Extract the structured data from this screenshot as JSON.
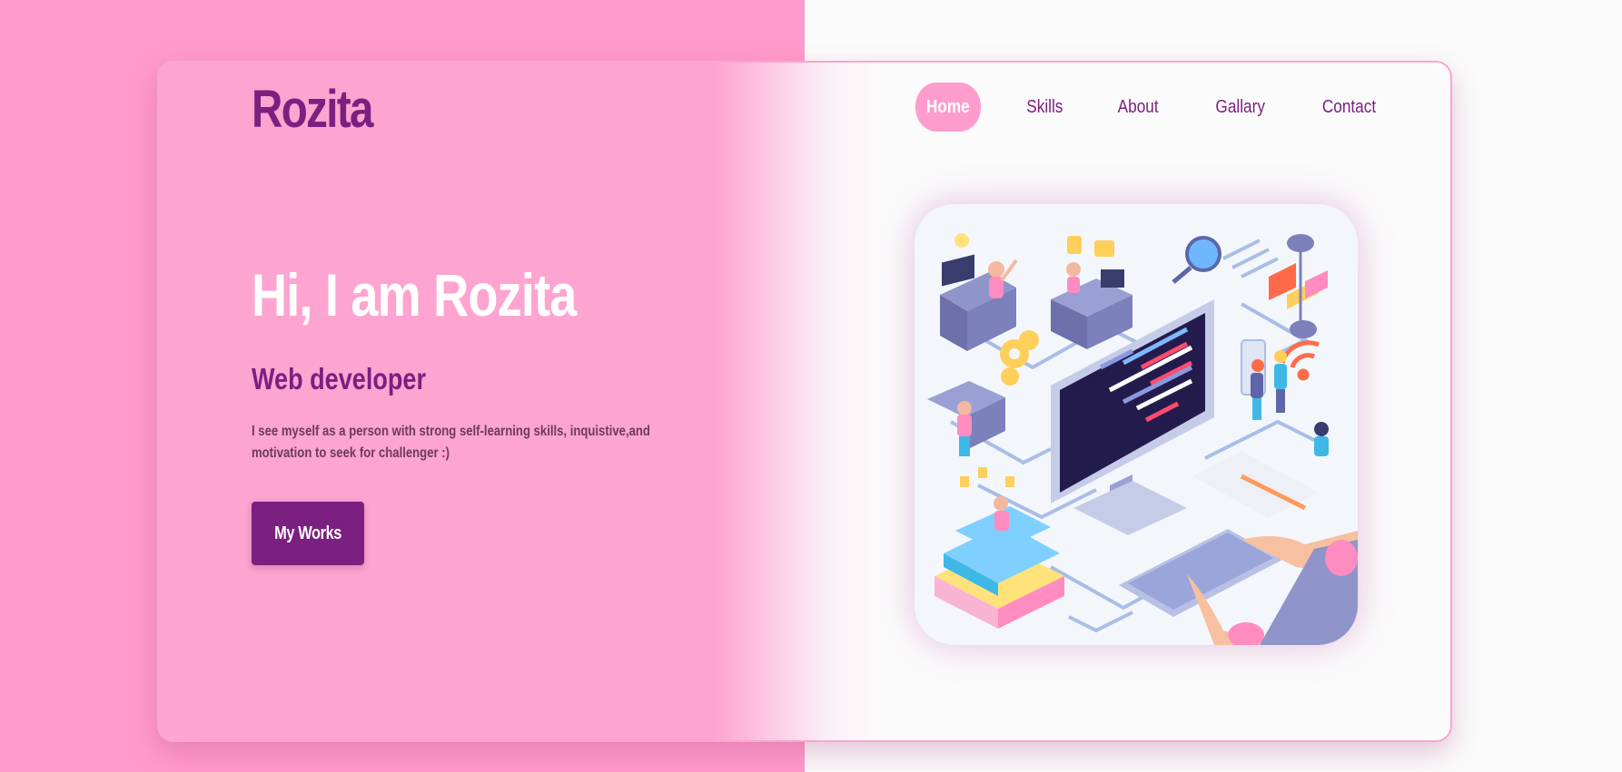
{
  "logo": {
    "text": "Rozita"
  },
  "nav": {
    "items": [
      {
        "label": "Home",
        "active": true
      },
      {
        "label": "Skills",
        "active": false
      },
      {
        "label": "About",
        "active": false
      },
      {
        "label": "Gallary",
        "active": false
      },
      {
        "label": "Contact",
        "active": false
      }
    ]
  },
  "hero": {
    "title": "Hi, I am Rozita",
    "role": "Web developer",
    "description": "I see myself as a person with strong self-learning skills, inquistive,and motivation to seek for challenger :)",
    "cta_label": "My Works"
  },
  "colors": {
    "brand_purple": "#7b1f80",
    "pink": "#fea4d0",
    "pink_dark": "#ff9bcb",
    "white_bg": "#fbfbfb"
  },
  "illustration": {
    "icon": "developer-workspace-illustration"
  }
}
